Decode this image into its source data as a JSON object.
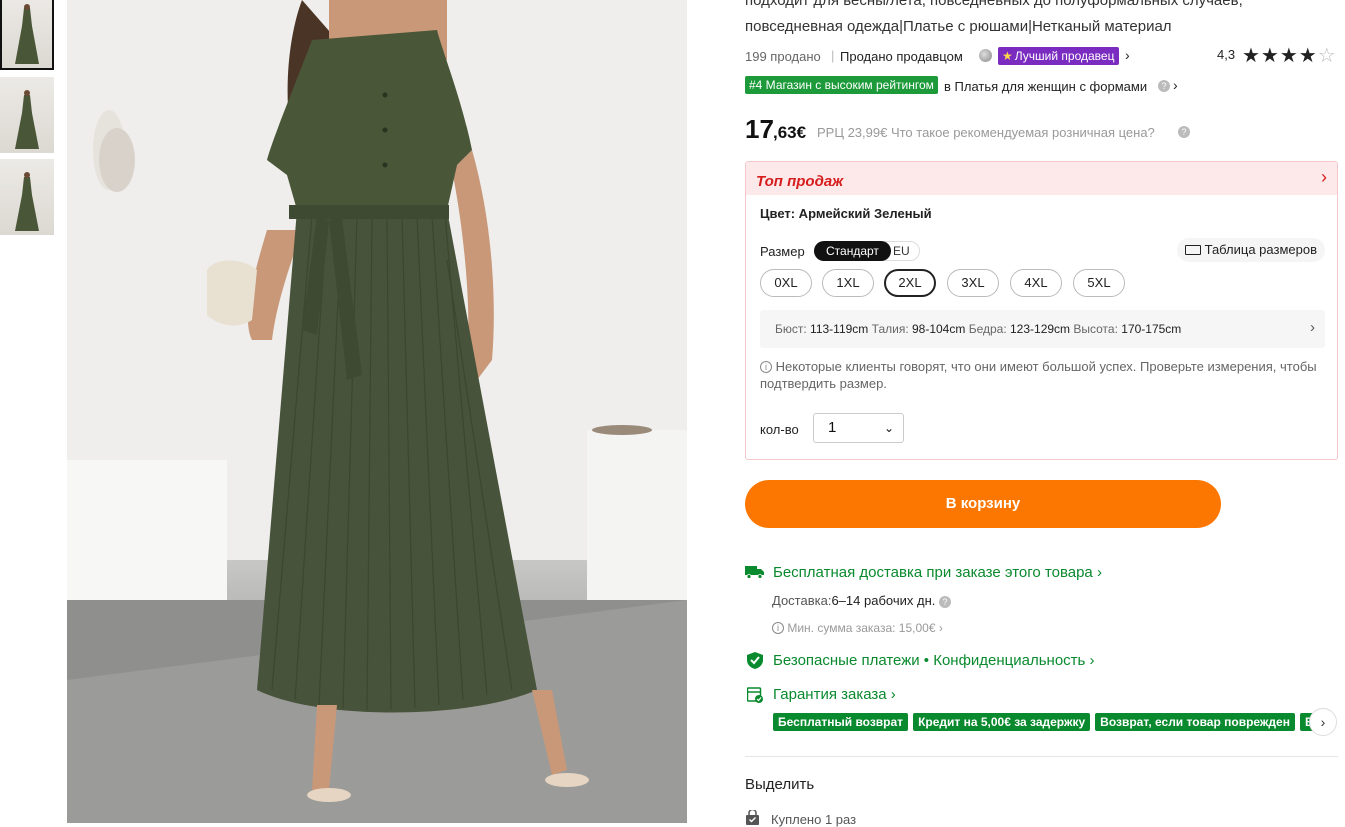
{
  "thumbnails": [
    {
      "label": "thumb-1"
    },
    {
      "label": "thumb-2"
    },
    {
      "label": "thumb-3"
    }
  ],
  "product": {
    "title_line_1": "подходит для весны/лета, повседневных до полуформальных случаев,",
    "title_line_2": "повседневная одежда|Платье с рюшами|Нетканый материал",
    "sold": "199 продано",
    "seller": "Продано продавцом",
    "best_seller_badge": "Лучший продавец",
    "rating": "4,3",
    "stars": "★★★★",
    "half_star": "☆",
    "rank_badge": "#4 Магазин с высоким рейтингом",
    "rank_text": "в Платья для женщин с формами",
    "price_int": "17",
    "price_frac": ",63€",
    "rrp": "РРЦ 23,99€ Что такое рекомендуемая розничная цена?"
  },
  "options": {
    "top_label": "Топ продаж",
    "color_label": "Цвет: Армейский Зеленый",
    "size_label": "Размер",
    "size_standard": "Стандарт",
    "size_eu": "EU",
    "size_chart": "Таблица размеров",
    "sizes": [
      "0XL",
      "1XL",
      "2XL",
      "3XL",
      "4XL",
      "5XL"
    ],
    "selected_size": "2XL",
    "measure_k1": "Бюст: ",
    "measure_v1": "113-119cm",
    "measure_k2": " Талия: ",
    "measure_v2": "98-104cm",
    "measure_k3": " Бедра: ",
    "measure_v3": "123-129cm",
    "measure_k4": " Высота: ",
    "measure_v4": "170-175cm",
    "notice": "Некоторые клиенты говорят, что они имеют большой успех. Проверьте измерения, чтобы подтвердить размер.",
    "qty_label": "кол-во",
    "qty_value": "1"
  },
  "cart": {
    "button": "В корзину"
  },
  "shipping": {
    "free_delivery": "Бесплатная доставка при заказе этого товара",
    "delivery_label": "Доставка:",
    "delivery_value": "6–14 рабочих дн.",
    "min_order": "Мин. сумма заказа: 15,00€",
    "secure": "Безопасные платежи • Конфиденциальность",
    "guarantee": "Гарантия заказа",
    "chips": [
      "Бесплатный возврат",
      "Кредит на 5,00€ за задержку",
      "Возврат, если товар поврежден",
      "Возврат"
    ]
  },
  "highlight": {
    "title": "Выделить",
    "bought": "Куплено 1 раз"
  },
  "colors": {
    "accent_orange": "#fb7701",
    "green": "#0a8a2e",
    "red": "#d61d1d",
    "purple": "#7b2cc0",
    "dress": "#4a5638"
  }
}
